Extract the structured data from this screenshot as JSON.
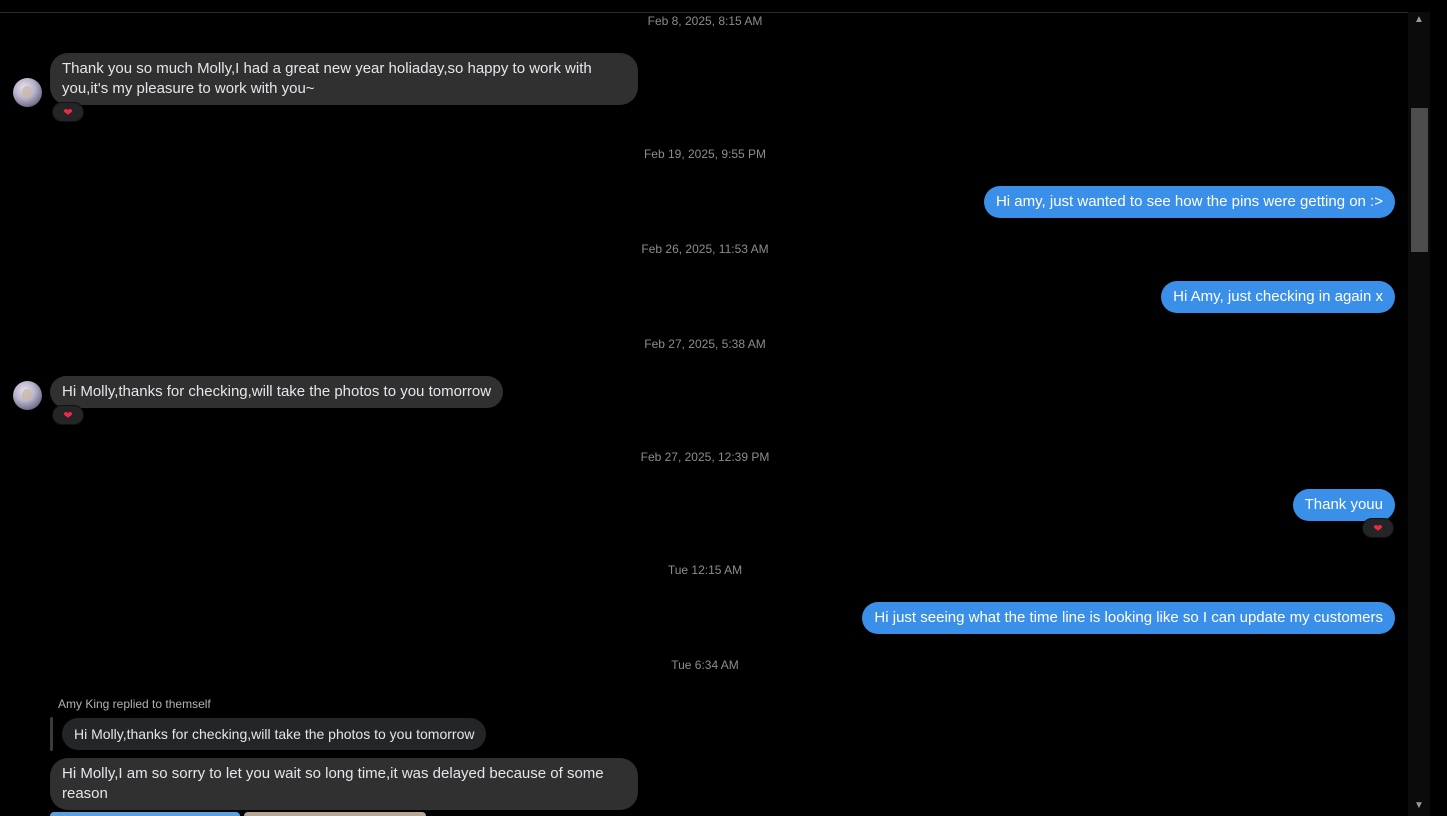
{
  "timestamps": {
    "t1": "Feb 8, 2025, 8:15 AM",
    "t2": "Feb 19, 2025, 9:55 PM",
    "t3": "Feb 26, 2025, 11:53 AM",
    "t4": "Feb 27, 2025, 5:38 AM",
    "t5": "Feb 27, 2025, 12:39 PM",
    "t6": "Tue 12:15 AM",
    "t7": "Tue 6:34 AM"
  },
  "messages": {
    "m1": "Thank you so much Molly,I had a great new year holiaday,so happy to work with you,it's my pleasure to work with you~",
    "m2": "Hi amy, just wanted to see how the pins were getting on :>",
    "m3": "Hi Amy, just checking in again x",
    "m4": "Hi Molly,thanks for checking,will take the photos to you tomorrow",
    "m5": "Thank youu",
    "m6": "Hi just seeing what the time line is looking like so I can update my customers",
    "m7": "Hi Molly,I am so sorry to let you wait so long time,it was delayed because of some reason"
  },
  "reply": {
    "meta": "Amy King replied to themself",
    "quote": "Hi Molly,thanks for checking,will take the photos to you tomorrow"
  },
  "reaction": {
    "glyph": "❤"
  },
  "colors": {
    "outgoing": "#3a8fe8",
    "incoming": "#303030",
    "reaction": "#f0284a"
  },
  "icons": {
    "avatar": "contact-avatar",
    "reaction": "heart-icon",
    "scroll_up": "chevron-up-icon",
    "scroll_down": "chevron-down-icon"
  }
}
